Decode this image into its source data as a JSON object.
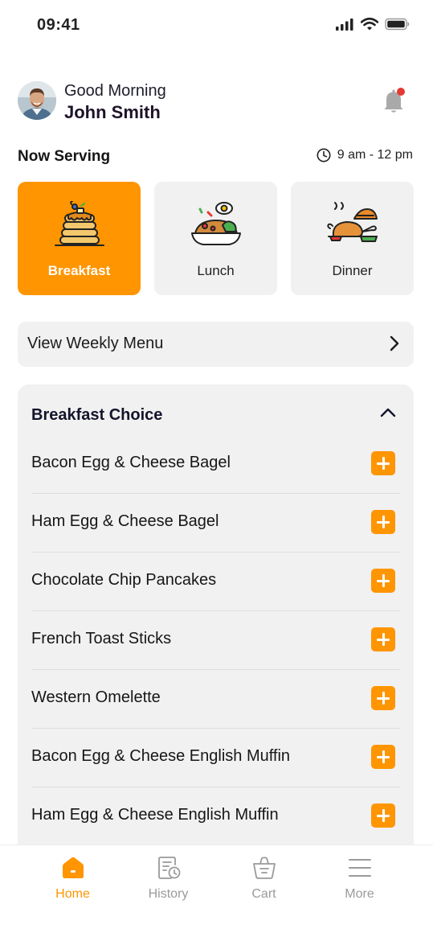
{
  "status_bar": {
    "time": "09:41"
  },
  "header": {
    "greeting": "Good Morning",
    "user_name": "John Smith"
  },
  "serving": {
    "label": "Now Serving",
    "time_range": "9 am - 12 pm"
  },
  "meals": [
    {
      "label": "Breakfast",
      "icon": "pancakes-icon",
      "active": true
    },
    {
      "label": "Lunch",
      "icon": "rice-plate-icon",
      "active": false
    },
    {
      "label": "Dinner",
      "icon": "roast-chicken-icon",
      "active": false
    }
  ],
  "weekly_menu": {
    "label": "View Weekly Menu"
  },
  "choice_panel": {
    "title": "Breakfast Choice",
    "items": [
      {
        "label": "Bacon Egg & Cheese Bagel"
      },
      {
        "label": "Ham Egg & Cheese Bagel"
      },
      {
        "label": "Chocolate Chip Pancakes"
      },
      {
        "label": "French Toast Sticks"
      },
      {
        "label": "Western Omelette"
      },
      {
        "label": "Bacon Egg & Cheese English Muffin"
      },
      {
        "label": "Ham Egg & Cheese English Muffin"
      }
    ]
  },
  "bottom_nav": [
    {
      "label": "Home",
      "icon": "home-icon",
      "active": true
    },
    {
      "label": "History",
      "icon": "history-icon",
      "active": false
    },
    {
      "label": "Cart",
      "icon": "cart-icon",
      "active": false
    },
    {
      "label": "More",
      "icon": "menu-icon",
      "active": false
    }
  ],
  "colors": {
    "accent": "#FF9500",
    "card_background": "#F1F1F1",
    "notification_dot": "#E53935",
    "inactive_nav": "#9A9A9A"
  }
}
